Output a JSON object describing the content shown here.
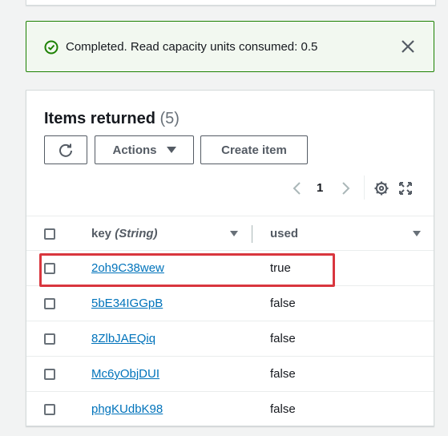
{
  "flash": {
    "message": "Completed. Read capacity units consumed: 0.5",
    "status_color": "#1d8102"
  },
  "items_panel": {
    "title": "Items returned",
    "count": "(5)",
    "toolbar": {
      "refresh_icon": "refresh-icon",
      "actions_label": "Actions",
      "create_label": "Create item"
    },
    "pagination": {
      "current_page": "1"
    },
    "columns": [
      {
        "name": "key",
        "type": "(String)"
      },
      {
        "name": "used"
      }
    ],
    "rows": [
      {
        "key": "2oh9C38wew",
        "used": "true",
        "highlighted": true
      },
      {
        "key": "5bE34IGGpB",
        "used": "false"
      },
      {
        "key": "8ZlbJAEQiq",
        "used": "false"
      },
      {
        "key": "Mc6yObjDUI",
        "used": "false"
      },
      {
        "key": "phgKUdbK98",
        "used": "false"
      }
    ]
  },
  "colors": {
    "link": "#0073bb",
    "highlight_border": "#d9363e"
  }
}
